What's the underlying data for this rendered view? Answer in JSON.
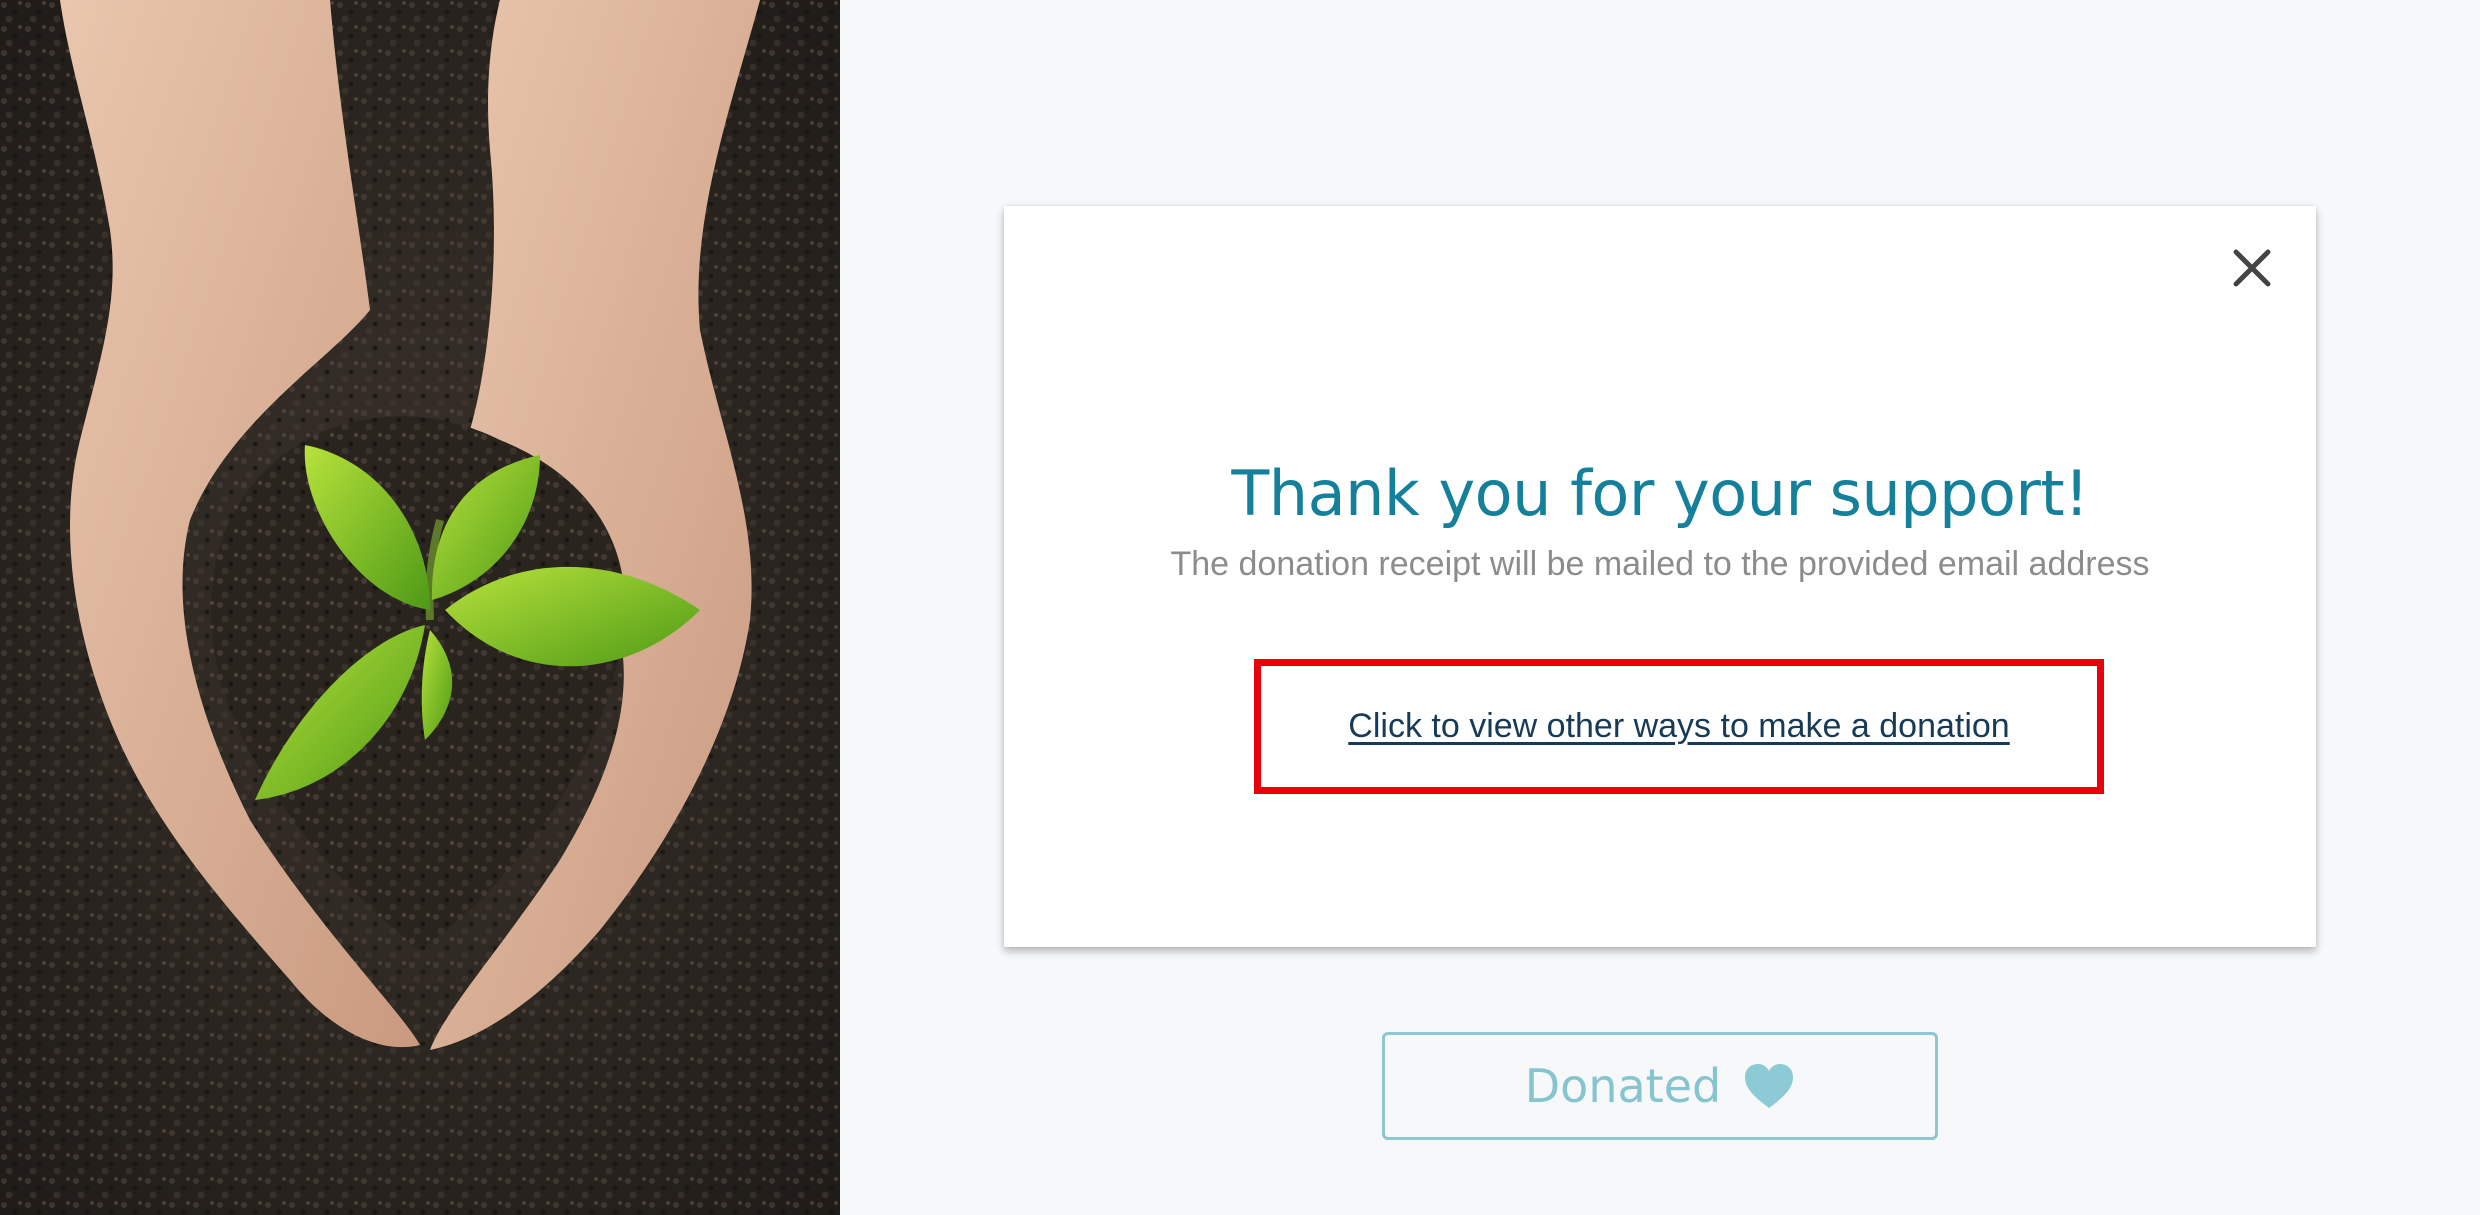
{
  "modal": {
    "title": "Thank you for your support!",
    "subtitle": "The donation receipt will be mailed to the provided email address",
    "other_ways_link": "Click to view other ways to make a donation",
    "close_icon": "close-icon"
  },
  "donated_button": {
    "label": "Donated",
    "icon": "heart-icon"
  },
  "hero_image": {
    "subject": "hands-holding-seedling-in-soil"
  },
  "colors": {
    "title": "#15809c",
    "subtitle": "#8c8c8c",
    "link": "#163a58",
    "highlight_border": "#e8000d",
    "donated_accent": "#86c4d0",
    "background": "#f6f8fa"
  }
}
